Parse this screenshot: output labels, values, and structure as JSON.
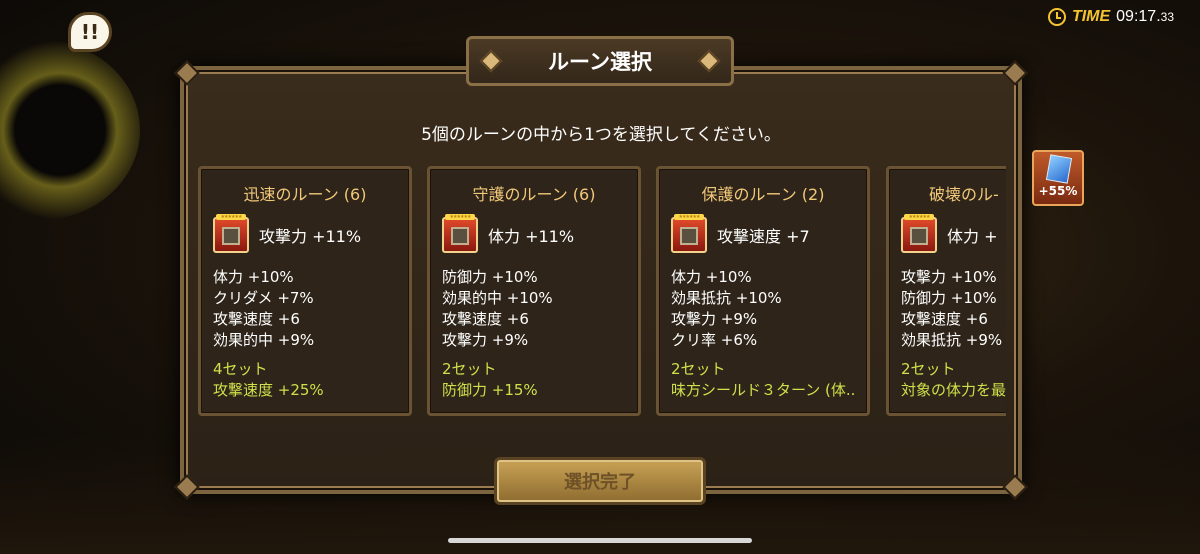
{
  "hud": {
    "alert_label": "!!",
    "time_label": "TIME",
    "time_main": "09:17.",
    "time_fraction": "33"
  },
  "dialog": {
    "title": "ルーン選択",
    "instruction": "5個のルーンの中から1つを選択してください。",
    "confirm_label": "選択完了"
  },
  "boost": {
    "label": "+55%"
  },
  "runes": [
    {
      "name": "迅速のルーン (6)",
      "main_stat": "攻撃力 +11%",
      "subs": [
        "体力 +10%",
        "クリダメ +7%",
        "攻撃速度 +6",
        "効果的中 +9%"
      ],
      "set_count": "4セット",
      "set_effect": "攻撃速度 +25%"
    },
    {
      "name": "守護のルーン (6)",
      "main_stat": "体力 +11%",
      "subs": [
        "防御力 +10%",
        "効果的中 +10%",
        "攻撃速度 +6",
        "攻撃力 +9%"
      ],
      "set_count": "2セット",
      "set_effect": "防御力 +15%"
    },
    {
      "name": "保護のルーン (2)",
      "main_stat": "攻撃速度 +7",
      "subs": [
        "体力 +10%",
        "効果抵抗 +10%",
        "攻撃力 +9%",
        "クリ率 +6%"
      ],
      "set_count": "2セット",
      "set_effect": "味方シールド３ターン (体.."
    },
    {
      "name": "破壊のル-",
      "main_stat": "体力 +",
      "subs": [
        "攻撃力 +10%",
        "防御力 +10%",
        "攻撃速度 +6",
        "効果抵抗 +9%"
      ],
      "set_count": "2セット",
      "set_effect": "対象の体力を最"
    }
  ]
}
